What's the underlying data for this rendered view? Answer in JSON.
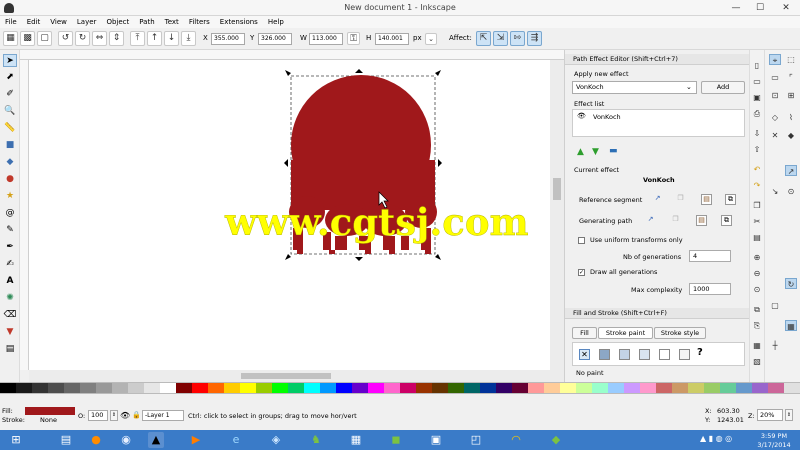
{
  "window": {
    "title": "New document 1 - Inkscape",
    "min": "—",
    "max": "☐",
    "close": "✕"
  },
  "menu": [
    "File",
    "Edit",
    "View",
    "Layer",
    "Object",
    "Path",
    "Text",
    "Filters",
    "Extensions",
    "Help"
  ],
  "toolbar": {
    "x_label": "X",
    "x_value": "355.000",
    "y_label": "Y",
    "y_value": "326.000",
    "w_label": "W",
    "w_value": "113.000",
    "h_label": "H",
    "h_value": "140.001",
    "unit": "px",
    "affect_label": "Affect:"
  },
  "watermark": "www.cgtsj.com",
  "colors": {
    "shape_fill": "#a0181b",
    "watermark": "#ffff00",
    "taskbar": "#3a7bc8"
  },
  "path_effect_editor": {
    "title": "Path Effect Editor (Shift+Ctrl+7)",
    "apply_label": "Apply new effect",
    "selected_effect": "VonKoch",
    "add_button": "Add",
    "effect_list_label": "Effect list",
    "effect_list_item": "VonKoch",
    "current_effect_label": "Current effect",
    "current_effect_name": "VonKoch",
    "reference_segment_label": "Reference segment",
    "generating_path_label": "Generating path",
    "uniform_transforms_label": "Use uniform transforms only",
    "generations_label": "Nb of generations",
    "generations_value": "4",
    "draw_all_label": "Draw all generations",
    "max_complexity_label": "Max complexity",
    "max_complexity_value": "1000"
  },
  "fill_stroke": {
    "title": "Fill and Stroke (Shift+Ctrl+F)",
    "tab_fill": "Fill",
    "tab_stroke_paint": "Stroke paint",
    "tab_stroke_style": "Stroke style",
    "unset_icon": "?",
    "no_paint": "No paint"
  },
  "status": {
    "fill_label": "Fill:",
    "fill_color": "#a0181b",
    "stroke_label": "Stroke:",
    "stroke_value": "None",
    "opacity_label": "O:",
    "opacity_value": "100",
    "layer": "-Layer 1",
    "message": "Ctrl: click to select in groups; drag to move hor/vert",
    "x_coord_label": "X:",
    "x_coord": "603.30",
    "y_coord_label": "Y:",
    "y_coord": "1243.01",
    "zoom_label": "Z:",
    "zoom": "20%"
  },
  "taskbar": {
    "time": "3:59 PM",
    "date": "3/17/2014"
  },
  "palette": [
    "#000000",
    "#1a1a1a",
    "#333333",
    "#4d4d4d",
    "#666666",
    "#808080",
    "#999999",
    "#b3b3b3",
    "#cccccc",
    "#e6e6e6",
    "#ffffff",
    "#800000",
    "#ff0000",
    "#ff6600",
    "#ffcc00",
    "#ffff00",
    "#99cc00",
    "#00ff00",
    "#00cc66",
    "#00ffff",
    "#0099ff",
    "#0000ff",
    "#6600cc",
    "#ff00ff",
    "#ff66cc",
    "#cc0066",
    "#993300",
    "#663300",
    "#336600",
    "#006666",
    "#003399",
    "#330066",
    "#660033",
    "#ff9999",
    "#ffcc99",
    "#ffff99",
    "#ccff99",
    "#99ffcc",
    "#99ccff",
    "#cc99ff",
    "#ff99cc",
    "#cc6666",
    "#cc9966",
    "#cccc66",
    "#99cc66",
    "#66cc99",
    "#6699cc",
    "#9966cc",
    "#cc6699",
    "#e0e0e0"
  ]
}
